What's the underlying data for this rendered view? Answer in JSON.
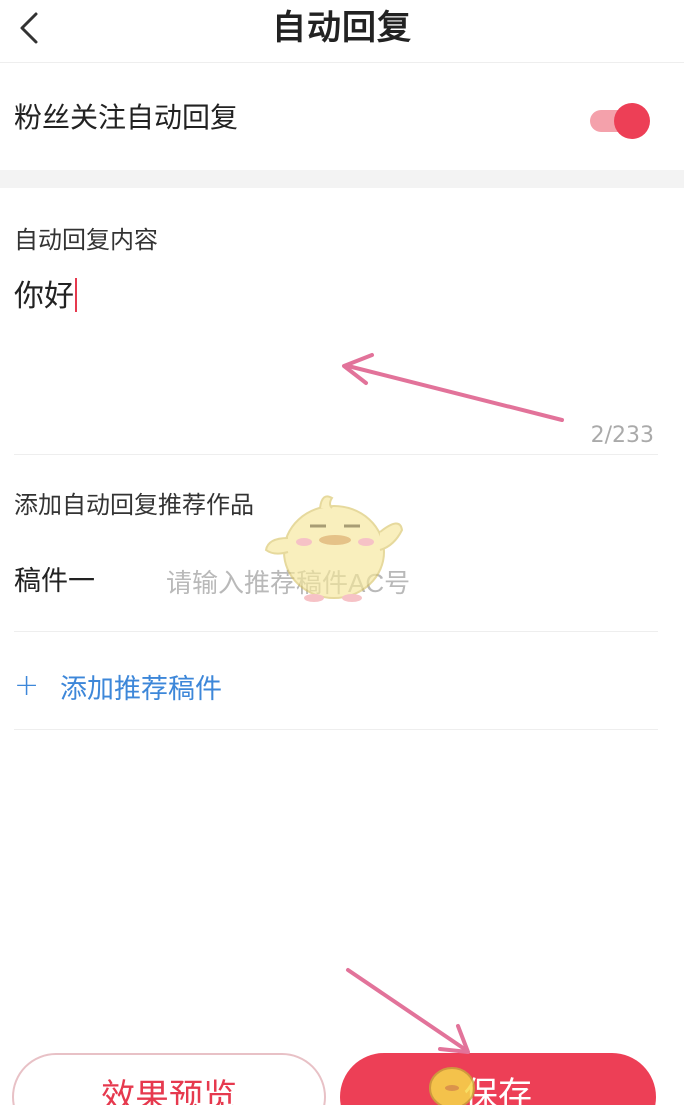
{
  "header": {
    "title": "自动回复",
    "back_icon": "chevron-left-icon"
  },
  "follow_reply": {
    "label": "粉丝关注自动回复",
    "enabled": true,
    "accent_color": "#ed3f56"
  },
  "content": {
    "label": "自动回复内容",
    "value": "你好",
    "char_count": "2/233"
  },
  "recommend": {
    "section_label": "添加自动回复推荐作品",
    "draft_label": "稿件一",
    "draft_placeholder": "请输入推荐稿件AC号",
    "add_label": "添加推荐稿件",
    "add_icon": "plus-icon",
    "link_color": "#3d87d9"
  },
  "footer": {
    "preview_label": "效果预览",
    "save_label": "保存"
  }
}
